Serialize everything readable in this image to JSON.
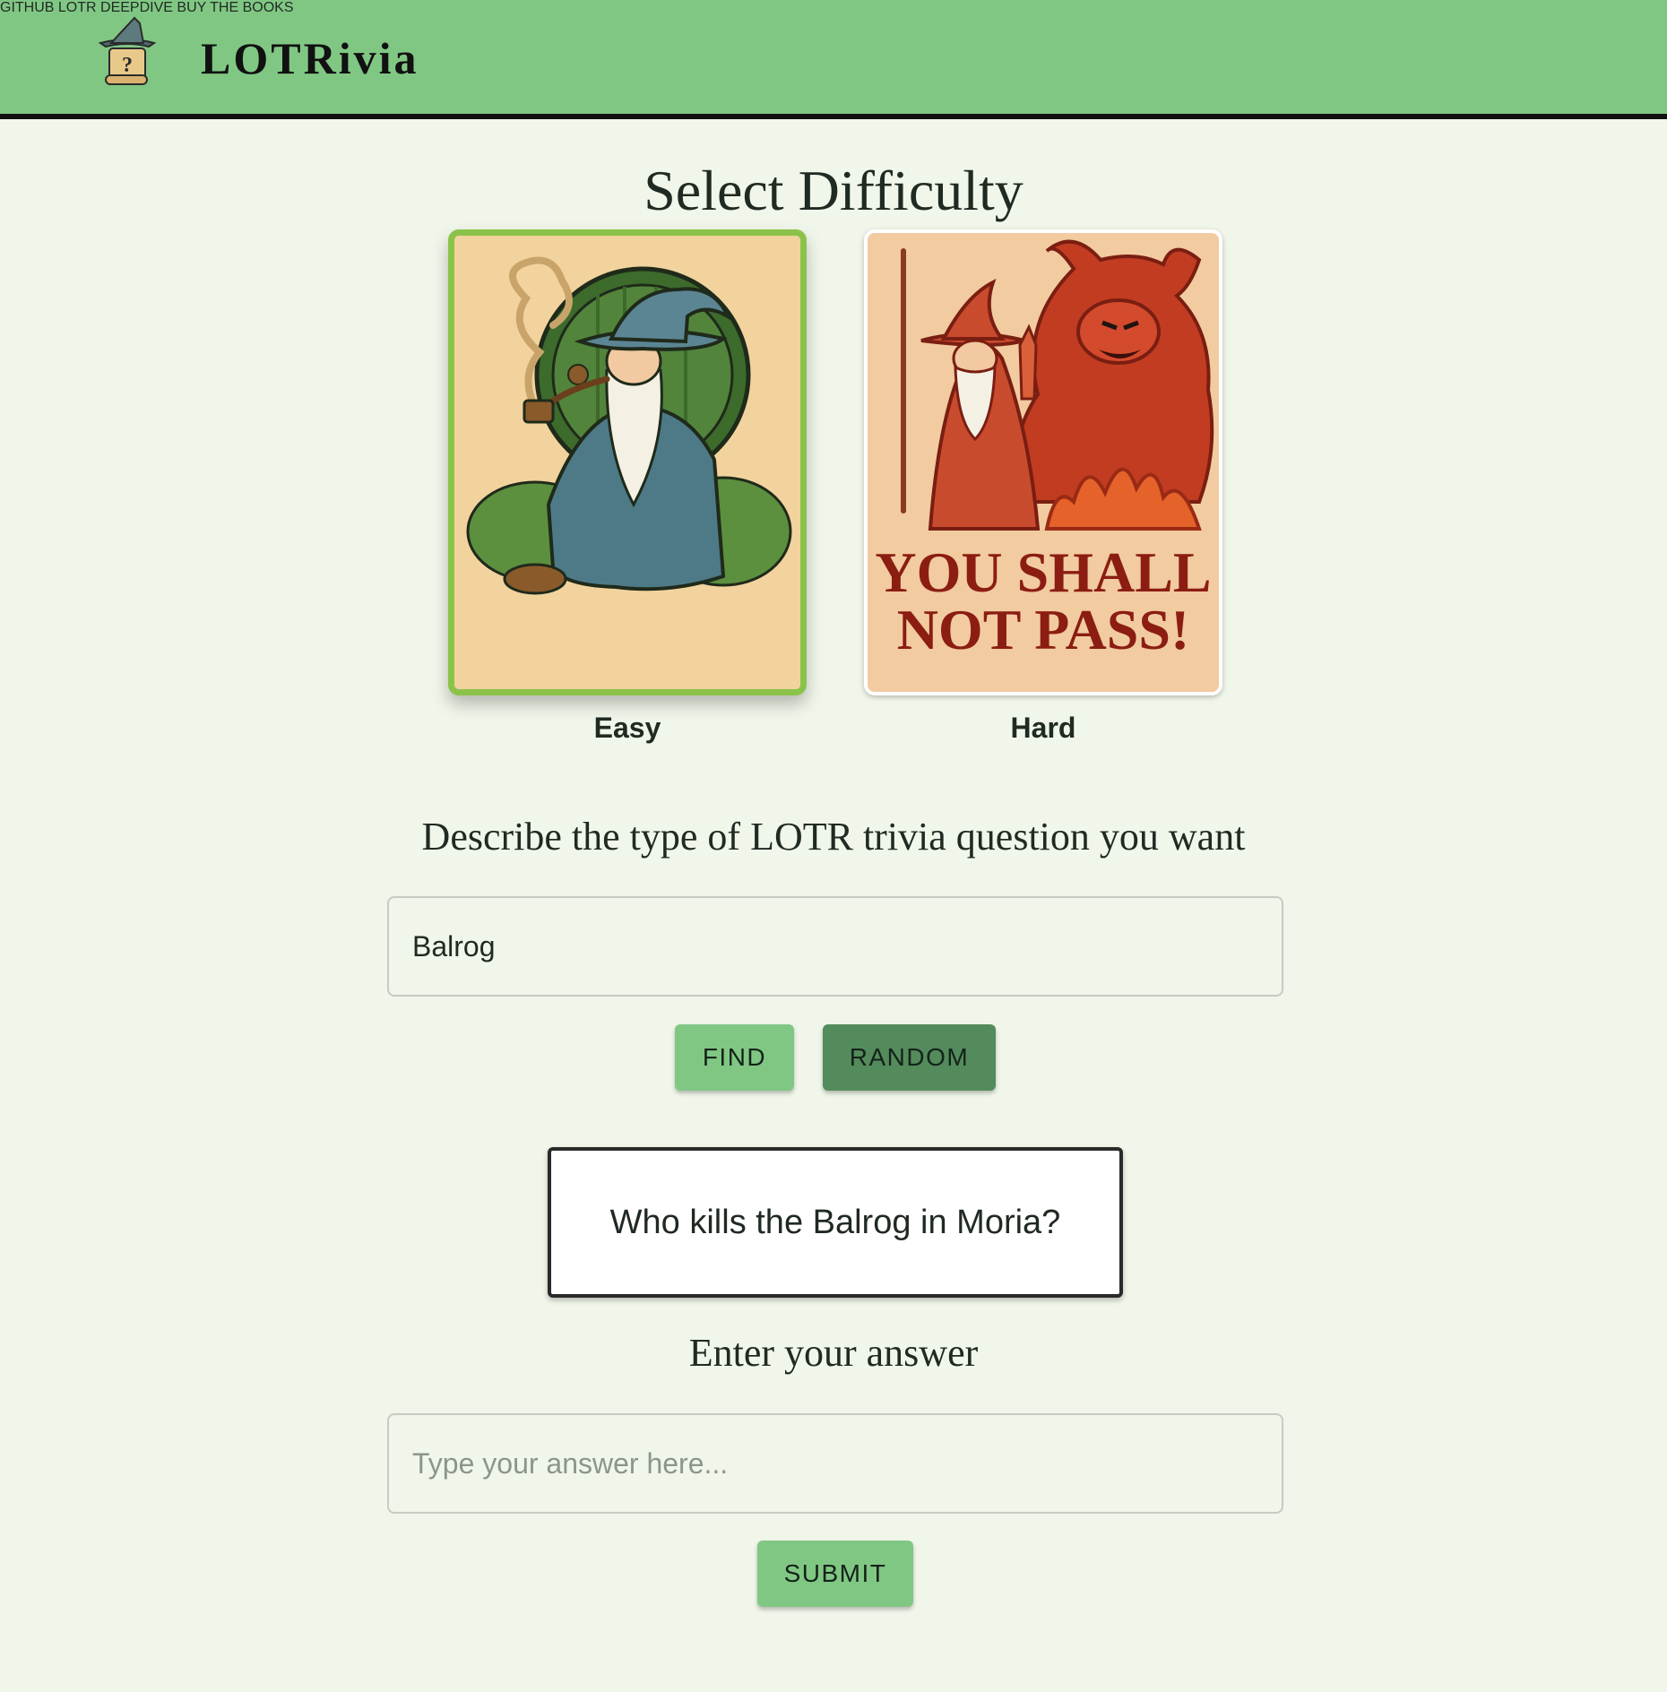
{
  "header": {
    "brand": "LOTRivia",
    "nav": [
      "GITHUB",
      "LOTR DEEPDIVE",
      "BUY THE BOOKS"
    ]
  },
  "difficulty": {
    "title": "Select Difficulty",
    "selected": "Easy",
    "options": [
      {
        "label": "Easy"
      },
      {
        "label": "Hard",
        "art_text_line1": "YOU SHALL",
        "art_text_line2": "NOT PASS!"
      }
    ]
  },
  "describe": {
    "title": "Describe the type of LOTR trivia question you want",
    "value": "Balrog"
  },
  "buttons": {
    "find": "FIND",
    "random": "RANDOM",
    "submit": "SUBMIT"
  },
  "question": {
    "text": "Who kills the Balrog in Moria?"
  },
  "answer": {
    "title": "Enter your answer",
    "placeholder": "Type your answer here..."
  },
  "colors": {
    "header_bg": "#81c784",
    "page_bg": "#f1f6ea",
    "selected_border": "#8bc34a",
    "random_btn": "#548b5c"
  },
  "icons": {
    "logo": "wizard-scroll-icon"
  }
}
